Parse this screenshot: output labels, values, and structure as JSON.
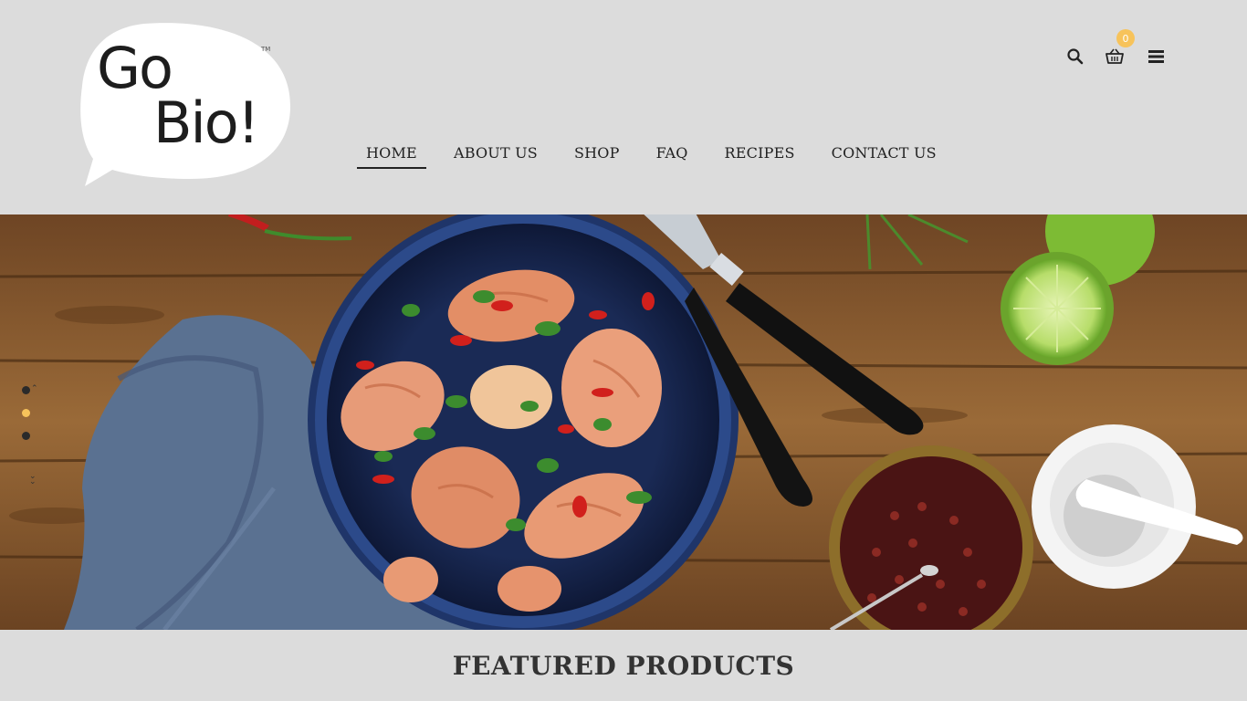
{
  "brand": {
    "logo_line1": "Go",
    "logo_line2": "Bio!",
    "logo_tm": "TM"
  },
  "nav": {
    "items": [
      {
        "label": "HOME",
        "active": true
      },
      {
        "label": "ABOUT US",
        "active": false
      },
      {
        "label": "SHOP",
        "active": false
      },
      {
        "label": "FAQ",
        "active": false
      },
      {
        "label": "RECIPES",
        "active": false
      },
      {
        "label": "CONTACT US",
        "active": false
      }
    ]
  },
  "tools": {
    "search_icon": "search-icon",
    "cart_icon": "basket-icon",
    "cart_count": "0",
    "menu_icon": "hamburger-icon"
  },
  "hero": {
    "slider": {
      "dot_count": 3,
      "active_index": 1
    }
  },
  "featured": {
    "title": "FEATURED PRODUCTS"
  },
  "colors": {
    "background": "#dcdcdc",
    "text": "#222222",
    "accent": "#f7c35b",
    "logo_bubble": "#ffffff",
    "wood": "#8a5a2c",
    "napkin": "#5a7191",
    "bowl": "#1d2f5c",
    "lime": "#8cc63f"
  }
}
